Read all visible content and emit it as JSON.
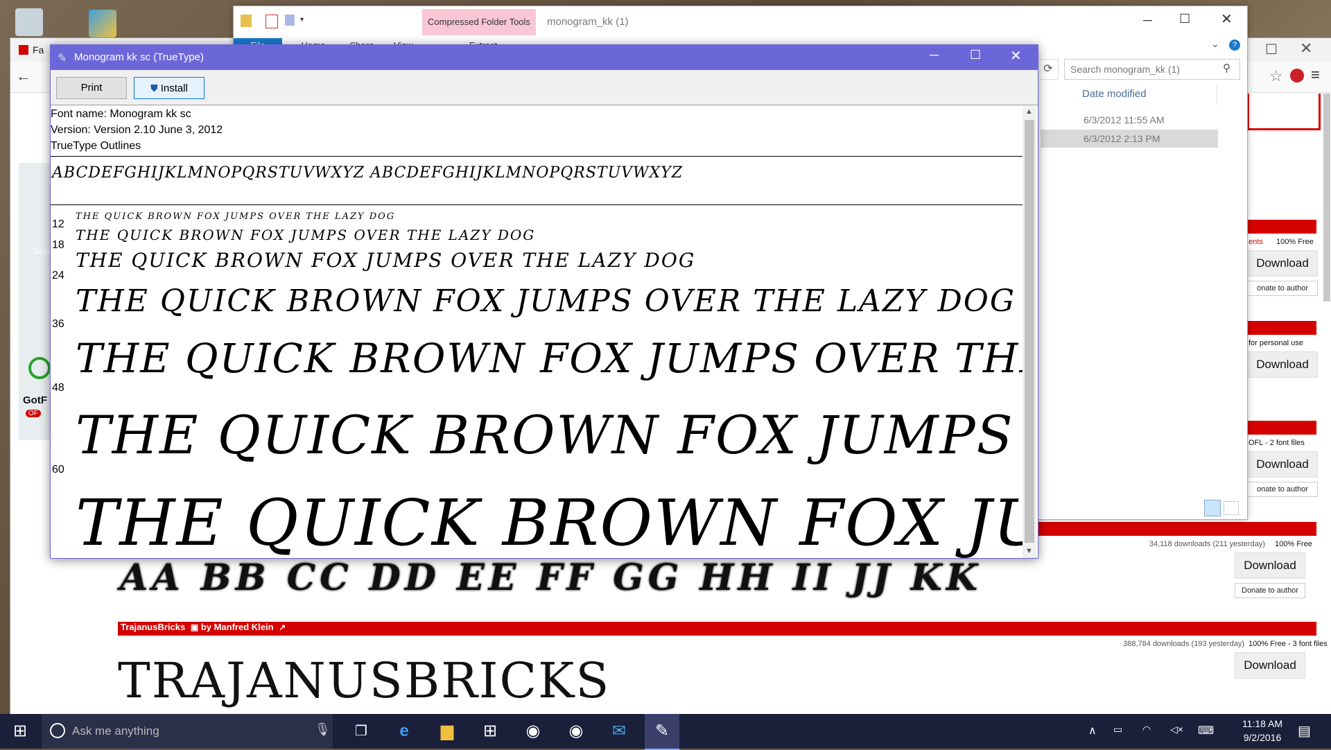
{
  "browser": {
    "tab_title": "Fa",
    "sidebar_left": [
      "Selec",
      "GotF",
      "OF"
    ],
    "listings": [
      {
        "meta": "ents",
        "license": "100% Free",
        "download": "Download",
        "donate": "onate to author"
      },
      {
        "meta": "",
        "license": "for personal use",
        "download": "Download",
        "donate": ""
      },
      {
        "meta": "",
        "license": "OFL - 2 font files",
        "download": "Download",
        "donate": "onate to author"
      },
      {
        "meta": "34,118 downloads (211 yesterday)",
        "license": "100% Free",
        "download": "Download",
        "donate": "Donate to author"
      },
      {
        "meta": "388,784 downloads (193 yesterday)",
        "license": "100% Free - 3 font files",
        "download": "Download",
        "donate": ""
      }
    ],
    "trajanus_header": "TrajanusBricks",
    "trajanus_by": "by Manfred Klein",
    "trajanus_preview": "TRAJANUSBRICKS",
    "monogram_preview": "AA BB CC DD EE FF GG HH II JJ KK"
  },
  "explorer": {
    "title": "monogram_kk (1)",
    "context_tab": "Compressed Folder Tools",
    "tabs": [
      "File",
      "Home",
      "Share",
      "View",
      "Extract"
    ],
    "search_placeholder": "Search monogram_kk (1)",
    "column_header": "Date modified",
    "rows": [
      {
        "date": "6/3/2012 11:55 AM"
      },
      {
        "date": "6/3/2012 2:13 PM"
      }
    ]
  },
  "viewer": {
    "title": "Monogram kk sc (TrueType)",
    "print_label": "Print",
    "install_label": "Install",
    "font_name": "Font name: Monogram kk sc",
    "version": "Version: Version 2.10 June 3, 2012",
    "outline": "TrueType Outlines",
    "alphabet": "ABCDEFGHIJKLMNOPQRSTUVWXYZ ABCDEFGHIJKLMNOPQRSTUVWXYZ",
    "sample_text": "THE QUICK BROWN FOX JUMPS OVER THE LAZY DOG",
    "sizes": [
      "12",
      "18",
      "24",
      "36",
      "48",
      "60"
    ]
  },
  "taskbar": {
    "search_placeholder": "Ask me anything",
    "time": "11:18 AM",
    "date": "9/2/2016"
  }
}
